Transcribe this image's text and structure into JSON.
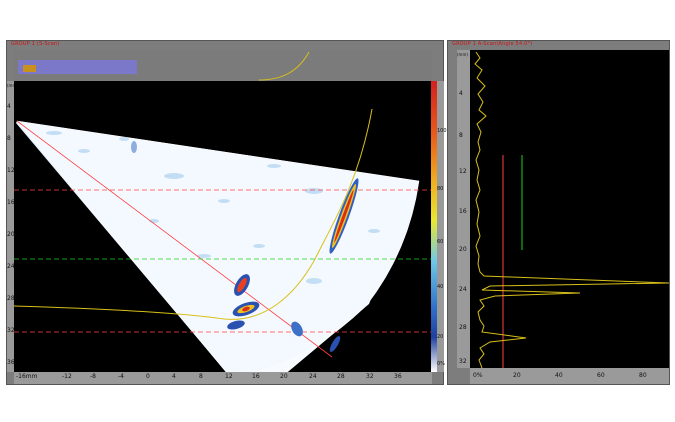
{
  "left_panel": {
    "title": "GROUP 1 (S-Scan)",
    "depth_unit": "(mm)",
    "depth_ticks": [
      "4",
      "8",
      "12",
      "16",
      "20",
      "24",
      "28",
      "32",
      "36"
    ],
    "index_ticks": [
      "-16mm",
      "-12",
      "-8",
      "-4",
      "0",
      "4",
      "8",
      "12",
      "16",
      "20",
      "24",
      "28",
      "32",
      "36"
    ],
    "colorbar_ticks": [
      "100",
      "80",
      "60",
      "40",
      "20",
      "0%"
    ],
    "colors": {
      "red_cursor": "#ff4040",
      "green_cursor": "#20d020",
      "yellow_trace": "#d8c018"
    }
  },
  "right_panel": {
    "title": "GROUP 1 A-Scan(Angle 54.0°)",
    "depth_unit": "(mm)",
    "depth_ticks": [
      "4",
      "8",
      "12",
      "16",
      "20",
      "24",
      "28",
      "32"
    ],
    "amplitude_ticks": [
      "0%",
      "20",
      "40",
      "60",
      "80"
    ]
  }
}
